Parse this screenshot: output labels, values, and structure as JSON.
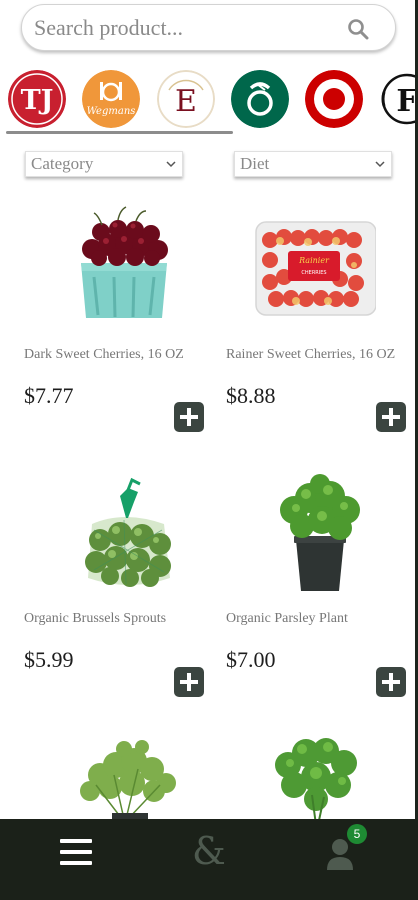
{
  "search": {
    "placeholder": "Search product..."
  },
  "stores": [
    {
      "name": "TJ",
      "label": "Trader Joe's"
    },
    {
      "name": "wegmans",
      "label": "Wegmans"
    },
    {
      "name": "E",
      "label": "Eataly"
    },
    {
      "name": "wholefoods",
      "label": "Whole Foods"
    },
    {
      "name": "target",
      "label": "Target"
    },
    {
      "name": "F",
      "label": "Fairway"
    }
  ],
  "filters": {
    "category": "Category",
    "diet": "Diet"
  },
  "products": [
    {
      "name": "Dark Sweet Cherries, 16 OZ",
      "price": "$7.77"
    },
    {
      "name": "Rainer Sweet Cherries, 16 OZ",
      "price": "$8.88"
    },
    {
      "name": "Organic Brussels Sprouts",
      "price": "$5.99"
    },
    {
      "name": "Organic Parsley Plant",
      "price": "$7.00"
    },
    {
      "name": "",
      "price": ""
    },
    {
      "name": "",
      "price": ""
    }
  ],
  "nav": {
    "cart_count": "5",
    "brand_glyph": "&"
  },
  "colors": {
    "nav_bg": "#1b2119",
    "add_button": "#3b4540",
    "badge": "#1e8a33",
    "tj_red": "#c8202f",
    "wegmans_orange": "#f0973a",
    "wholefoods_green": "#00674b",
    "target_red": "#cc0000"
  }
}
